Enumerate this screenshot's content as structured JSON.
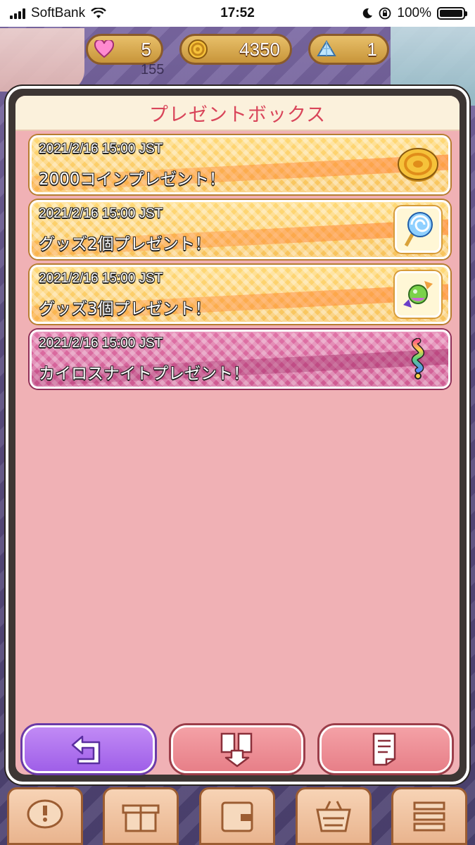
{
  "status_bar": {
    "carrier": "SoftBank",
    "time": "17:52",
    "battery": "100%"
  },
  "resources": [
    {
      "icon": "heart-icon",
      "value": "5"
    },
    {
      "icon": "coin-icon",
      "value": "4350"
    },
    {
      "icon": "gem-icon",
      "value": "1"
    }
  ],
  "background_level": "155",
  "modal": {
    "title": "プレゼントボックス",
    "items": [
      {
        "date": "2021/2/16 15:00 JST",
        "label": "2000コインプレゼント！",
        "icon": "coin-icon",
        "style": "yellow"
      },
      {
        "date": "2021/2/16 15:00 JST",
        "label": "グッズ2個プレゼント！",
        "icon": "lollipop-icon",
        "style": "yellow"
      },
      {
        "date": "2021/2/16 15:00 JST",
        "label": "グッズ3個プレゼント！",
        "icon": "candy-icon",
        "style": "yellow"
      },
      {
        "date": "2021/2/16 15:00 JST",
        "label": "カイロスナイトプレゼント！",
        "icon": "rainbow-swirl-icon",
        "style": "pink"
      }
    ]
  },
  "buttons": {
    "back_icon": "return-arrow-icon",
    "receive_icon": "receive-all-icon",
    "history_icon": "history-list-icon"
  },
  "bottom_nav": [
    "speech-alert-icon",
    "gift-icon",
    "wallet-icon",
    "shop-basket-icon",
    "menu-icon"
  ],
  "colors": {
    "title": "#d9455a",
    "panel_bg": "#f0b1b5",
    "item_yellow": "#f8c35c",
    "item_pink": "#cf5b93",
    "back_button": "#9f5fe8",
    "action_button": "#e77f88"
  }
}
